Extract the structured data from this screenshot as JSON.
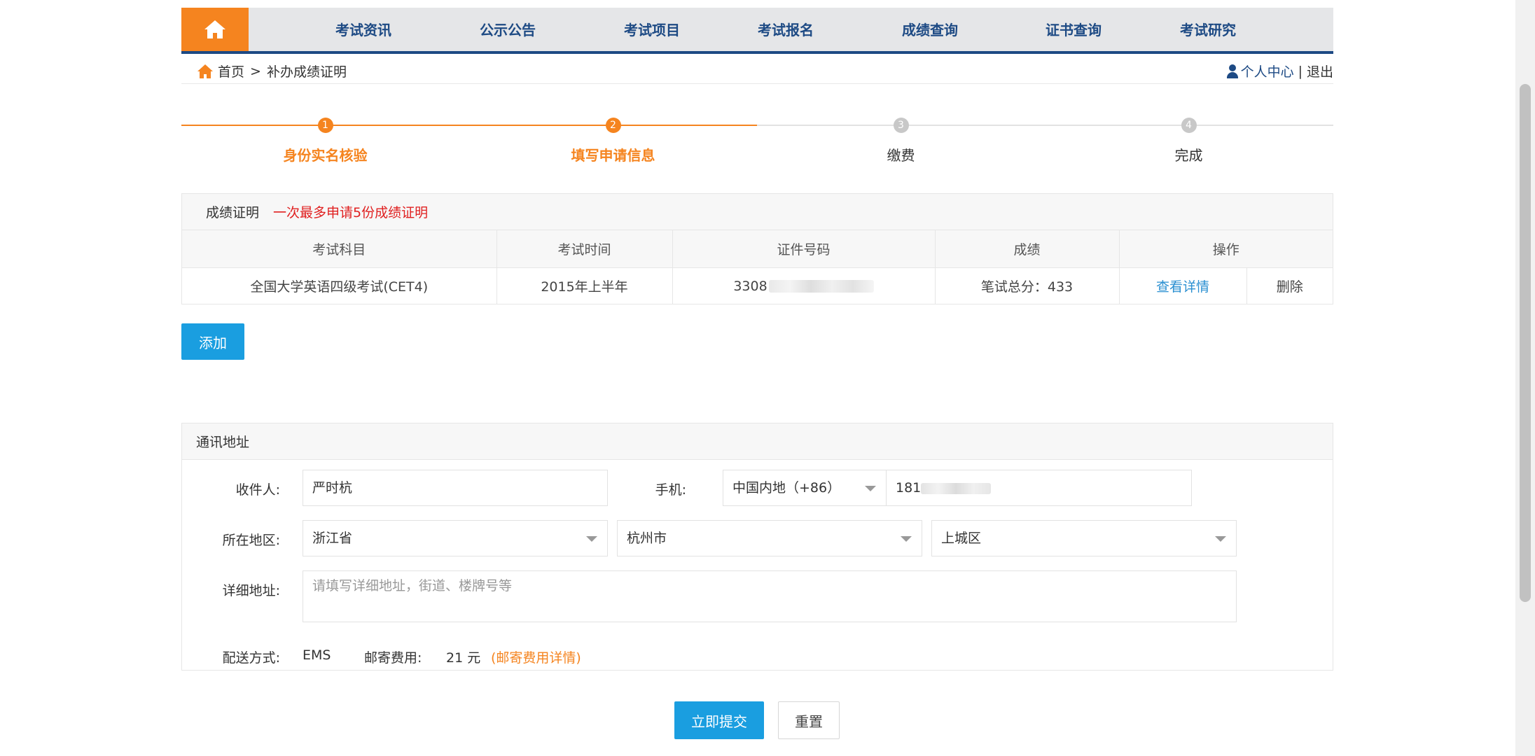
{
  "nav": {
    "items": [
      "考试资讯",
      "公示公告",
      "考试项目",
      "考试报名",
      "成绩查询",
      "证书查询",
      "考试研究"
    ]
  },
  "breadcrumb": {
    "home": "首页",
    "separator": ">",
    "current": "补办成绩证明"
  },
  "user": {
    "center": "个人中心",
    "divider": "|",
    "logout": "退出"
  },
  "steps": [
    {
      "num": "1",
      "label": "身份实名核验",
      "state": "done"
    },
    {
      "num": "2",
      "label": "填写申请信息",
      "state": "done"
    },
    {
      "num": "3",
      "label": "缴费",
      "state": "todo"
    },
    {
      "num": "4",
      "label": "完成",
      "state": "todo"
    }
  ],
  "score": {
    "title": "成绩证明",
    "warning": "一次最多申请5份成绩证明",
    "columns": [
      "考试科目",
      "考试时间",
      "证件号码",
      "成绩",
      "操作"
    ],
    "rows": [
      {
        "subject": "全国大学英语四级考试(CET4)",
        "time": "2015年上半年",
        "id_prefix": "3308",
        "score": "笔试总分：433",
        "view": "查看详情",
        "delete": "删除"
      }
    ],
    "add_label": "添加"
  },
  "address": {
    "title": "通讯地址",
    "recipient_label": "收件人:",
    "recipient_value": "严时杭",
    "phone_label": "手机:",
    "phone_region": "中国内地（+86）",
    "phone_prefix": "181",
    "region_label": "所在地区:",
    "province": "浙江省",
    "city": "杭州市",
    "district": "上城区",
    "detail_label": "详细地址:",
    "detail_placeholder": "请填写详细地址，街道、楼牌号等",
    "ship_label": "配送方式:",
    "ship_value": "EMS",
    "fee_label": "邮寄费用:",
    "fee_value": "21 元",
    "fee_link": "(邮寄费用详情)"
  },
  "actions": {
    "submit": "立即提交",
    "reset": "重置"
  },
  "colors": {
    "brand_orange": "#f5841f",
    "nav_blue": "#1d4a84",
    "button_blue": "#1a9ee0",
    "warn_red": "#e02020"
  }
}
